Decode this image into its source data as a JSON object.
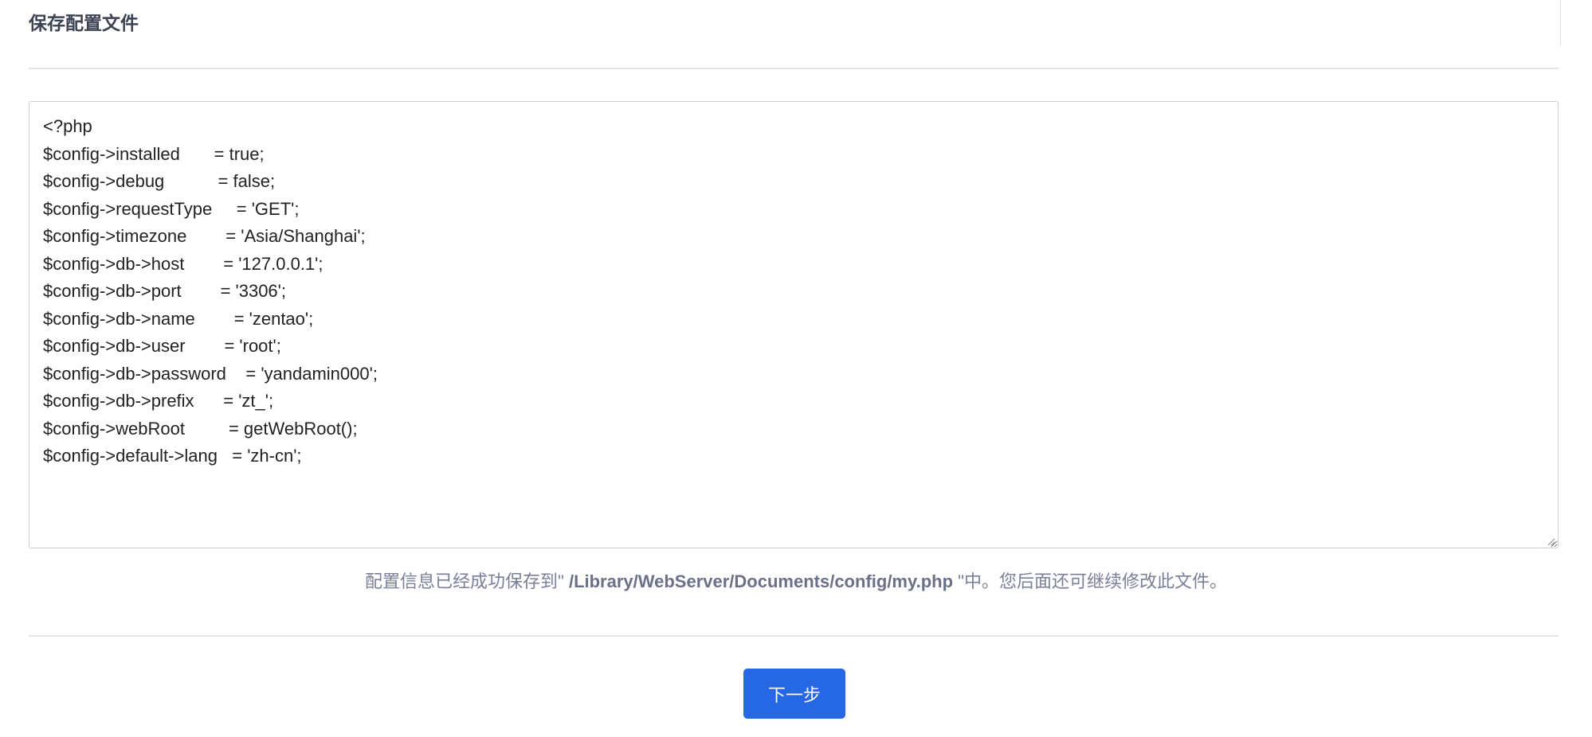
{
  "page_title": "保存配置文件",
  "config_text": "<?php\n$config->installed       = true;\n$config->debug           = false;\n$config->requestType     = 'GET';\n$config->timezone        = 'Asia/Shanghai';\n$config->db->host        = '127.0.0.1';\n$config->db->port        = '3306';\n$config->db->name        = 'zentao';\n$config->db->user        = 'root';\n$config->db->password    = 'yandamin000';\n$config->db->prefix      = 'zt_';\n$config->webRoot         = getWebRoot();\n$config->default->lang   = 'zh-cn';\n",
  "info": {
    "prefix": "配置信息已经成功保存到\" ",
    "path": "/Library/WebServer/Documents/config/my.php",
    "suffix": " \"中。您后面还可继续修改此文件。"
  },
  "next_button": "下一步",
  "colors": {
    "primary": "#2667e3",
    "info_text": "#7a7f99"
  }
}
